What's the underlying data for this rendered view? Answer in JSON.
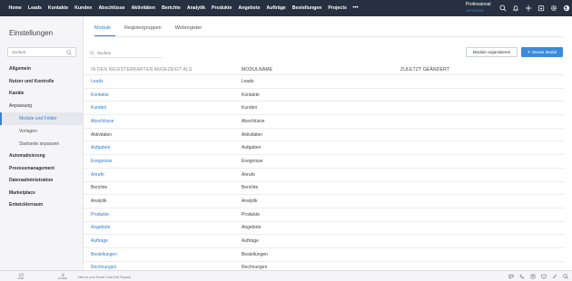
{
  "topnav": {
    "items": [
      "Home",
      "Leads",
      "Kontakte",
      "Kunden",
      "Abschlüsse",
      "Aktivitäten",
      "Berichte",
      "Analytik",
      "Produkte",
      "Angebote",
      "Aufträge",
      "Bestellungen",
      "Projects"
    ],
    "more": "•••",
    "edition_name": "Professional",
    "edition_action": "UPGRADE",
    "icons": [
      "search-icon",
      "bell-icon",
      "plus-icon",
      "calendar-icon",
      "settings-icon",
      "apps-icon"
    ]
  },
  "sidebar": {
    "title": "Einstellungen",
    "search_placeholder": "Suchen",
    "items": [
      {
        "label": "Allgemein",
        "type": "section"
      },
      {
        "label": "Nutzer und Kontrolle",
        "type": "section"
      },
      {
        "label": "Kanäle",
        "type": "section"
      },
      {
        "label": "Anpassung",
        "type": "section-open"
      },
      {
        "label": "Module und Felder",
        "type": "sub-active"
      },
      {
        "label": "Vorlagen",
        "type": "sub"
      },
      {
        "label": "Startseite anpassen",
        "type": "sub"
      },
      {
        "label": "Automatisierung",
        "type": "section"
      },
      {
        "label": "Prozessmanagement",
        "type": "section"
      },
      {
        "label": "Datenadministration",
        "type": "section"
      },
      {
        "label": "Marketplace",
        "type": "section"
      },
      {
        "label": "Entwicklerraum",
        "type": "section"
      }
    ]
  },
  "main": {
    "tabs": [
      "Module",
      "Registergruppen",
      "Webregister"
    ],
    "active_tab": "Module",
    "search_placeholder": "Suchen",
    "organize_button": "Module organisieren",
    "new_button": "Neues Modul",
    "columns": [
      "IN DEN REGISTERKARTEN ANGEZEIGT ALS",
      "MODULNAME",
      "ZULETZT GEÄNDERT"
    ],
    "rows": [
      {
        "display": "Leads",
        "module": "Leads",
        "modified": "",
        "link": true
      },
      {
        "display": "Kontakte",
        "module": "Kontakte",
        "modified": "",
        "link": true
      },
      {
        "display": "Kunden",
        "module": "Kunden",
        "modified": "",
        "link": true
      },
      {
        "display": "Abschlüsse",
        "module": "Abschlüsse",
        "modified": "",
        "link": true
      },
      {
        "display": "Aktivitäten",
        "module": "Aktivitäten",
        "modified": "",
        "link": false
      },
      {
        "display": "Aufgaben",
        "module": "Aufgaben",
        "modified": "",
        "link": true
      },
      {
        "display": "Ereignisse",
        "module": "Ereignisse",
        "modified": "",
        "link": true
      },
      {
        "display": "Anrufe",
        "module": "Anrufe",
        "modified": "",
        "link": true
      },
      {
        "display": "Berichte",
        "module": "Berichte",
        "modified": "",
        "link": false
      },
      {
        "display": "Analytik",
        "module": "Analytik",
        "modified": "",
        "link": false
      },
      {
        "display": "Produkte",
        "module": "Produkte",
        "modified": "",
        "link": true
      },
      {
        "display": "Angebote",
        "module": "Angebote",
        "modified": "",
        "link": true
      },
      {
        "display": "Aufträge",
        "module": "Aufträge",
        "modified": "",
        "link": true
      },
      {
        "display": "Bestellungen",
        "module": "Bestellungen",
        "modified": "",
        "link": true
      },
      {
        "display": "Rechnungen",
        "module": "Rechnungen",
        "modified": "",
        "link": true
      }
    ]
  },
  "bottombar": {
    "left_buttons": [
      "Chats",
      "Kontakte"
    ],
    "input_placeholder": "Here is your Smart Chat (Ctrl+Space)",
    "right_icons": [
      "chat-icon",
      "phone-icon",
      "contacts-icon",
      "monitor-icon",
      "edit-icon",
      "zoom-icon"
    ]
  },
  "colors": {
    "topbar": "#263040",
    "accent": "#3b8bdb",
    "link": "#2f7dd3"
  }
}
